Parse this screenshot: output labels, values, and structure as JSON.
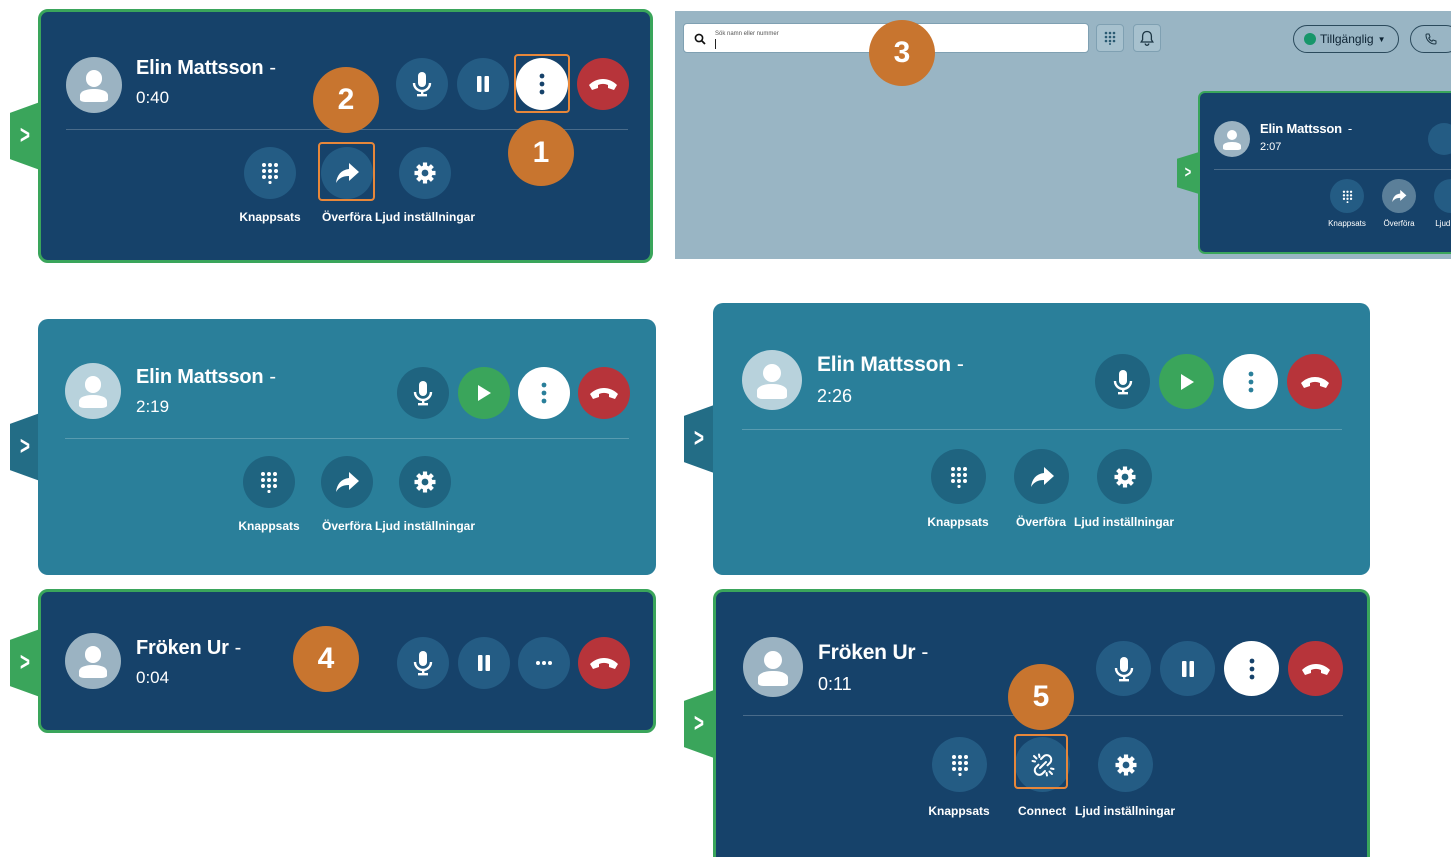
{
  "colors": {
    "active_bg": "#16426a",
    "held_bg": "#2a7f9a",
    "active_border": "#3aa55b",
    "hangup": "#b7343a",
    "resume": "#3aa55b",
    "step_badge": "#c8752f",
    "highlight": "#e7873a"
  },
  "panel1": {
    "caller": "Elin Mattsson",
    "dash": "-",
    "timer": "0:40",
    "labels": {
      "keypad": "Knappsats",
      "transfer": "Överföra",
      "audio": "Ljud inställningar"
    }
  },
  "panel2": {
    "search_placeholder": "Sök namn eller nummer",
    "status_label": "Tillgänglig",
    "mini_card": {
      "caller": "Elin Mattsson",
      "dash": "-",
      "timer": "2:07",
      "labels": {
        "keypad": "Knappsats",
        "transfer": "Överföra",
        "audio": "Ljud ins"
      }
    }
  },
  "panel3": {
    "caller": "Elin Mattsson",
    "dash": "-",
    "timer": "2:19",
    "labels": {
      "keypad": "Knappsats",
      "transfer": "Överföra",
      "audio": "Ljud inställningar"
    }
  },
  "panel4": {
    "caller": "Fröken Ur",
    "dash": "-",
    "timer": "0:04"
  },
  "panel5": {
    "caller": "Elin Mattsson",
    "dash": "-",
    "timer": "2:26",
    "labels": {
      "keypad": "Knappsats",
      "transfer": "Överföra",
      "audio": "Ljud inställningar"
    }
  },
  "panel6": {
    "caller": "Fröken Ur",
    "dash": "-",
    "timer": "0:11",
    "labels": {
      "keypad": "Knappsats",
      "connect": "Connect",
      "audio": "Ljud inställningar"
    }
  },
  "steps": {
    "s1": "1",
    "s2": "2",
    "s3": "3",
    "s4": "4",
    "s5": "5"
  }
}
